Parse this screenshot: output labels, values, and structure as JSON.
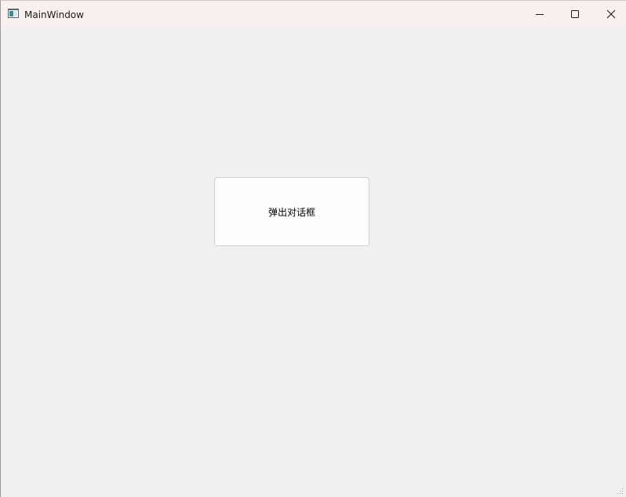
{
  "window": {
    "title": "MainWindow",
    "icons": {
      "app": "app-window-icon",
      "minimize": "minimize-icon",
      "maximize": "maximize-icon",
      "close": "close-icon"
    }
  },
  "main": {
    "popup_button_label": "弹出对话框"
  },
  "colors": {
    "titlebar_bg": "#f8efef",
    "client_bg": "#f0f0f0",
    "button_bg": "#fdfdfd",
    "button_border": "#d0d0d0"
  }
}
